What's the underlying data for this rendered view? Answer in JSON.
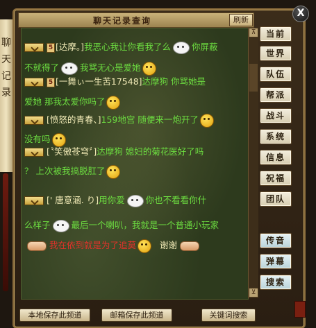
{
  "window": {
    "title": "聊天记录查询",
    "close_glyph": "X",
    "refresh_label": "刷新"
  },
  "scroll_label": "聊天记录",
  "scrollbar": {
    "up_glyph": "⊼",
    "down_glyph": "⊻"
  },
  "nav": [
    {
      "label": "当前"
    },
    {
      "label": "世界"
    },
    {
      "label": "队伍"
    },
    {
      "label": "帮派"
    },
    {
      "label": "战斗"
    },
    {
      "label": "系统"
    },
    {
      "label": "信息"
    },
    {
      "label": "祝福"
    },
    {
      "label": "团队"
    }
  ],
  "nav2": [
    {
      "label": "传音"
    },
    {
      "label": "弹幕"
    },
    {
      "label": "搜索"
    }
  ],
  "messages": {
    "m1": {
      "level": "5",
      "name": "[达摩。]",
      "t1": "我恶心我让你看我了么",
      "t2": "你屏蔽",
      "t3": "不就得了",
      "t4": "我骂无心是爱她"
    },
    "m2": {
      "level": "5",
      "name": "[一舞ぃ一生苦17548]",
      "t1": "达摩狗 你骂她是",
      "t2": "爱她 那我太爱你吗了"
    },
    "m3": {
      "name": "[愤怒的青春、]",
      "t1": "159地宫 随便来一炮开了",
      "t2": "没有吗"
    },
    "m4": {
      "name": "[〝笑傲苍穹〞]",
      "t1": "达摩狗 媳妇的菊花医好了吗",
      "t2": "？ 上次被我搞脱肛了"
    },
    "m5": {
      "name": "[' 唐意涵. り]",
      "t1": "用你爱",
      "t2": "你也不看看你什",
      "t3": "么样子",
      "t4": "最后一个喇叭，我就是一个普通小玩家"
    },
    "m6": {
      "t1": "我在依到就是为了追莫",
      "t2": "谢谢"
    }
  },
  "bottom_buttons": {
    "save_channel": "本地保存此频道",
    "mail_channel": "邮箱保存此频道",
    "keyword_search": "关键词搜索"
  }
}
